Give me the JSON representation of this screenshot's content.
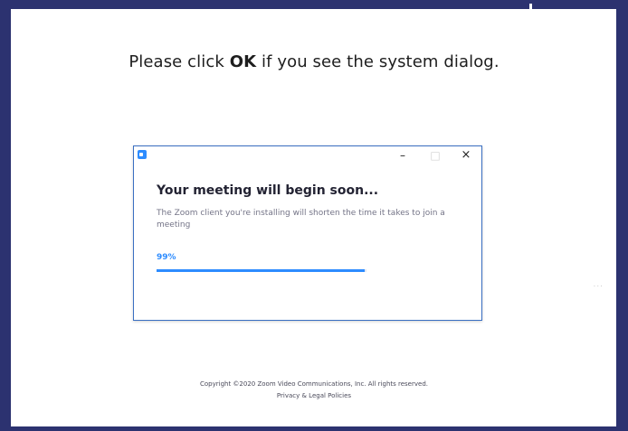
{
  "page": {
    "instruction_prefix": "Please click ",
    "instruction_bold": "OK",
    "instruction_suffix": " if you see the system dialog."
  },
  "dialog": {
    "app_icon": "zoom-app-icon",
    "minimize_label": "–",
    "maximize_label": "□",
    "close_label": "×",
    "title": "Your meeting will begin soon...",
    "description": "The Zoom client you're installing will shorten the time it takes to join a meeting",
    "progress_text": "99%",
    "progress_value": 0.99,
    "accent_color": "#2d8cff"
  },
  "footer": {
    "copyright": "Copyright ©2020 Zoom Video Communications, Inc. All rights reserved.",
    "privacy_link": "Privacy & Legal Policies"
  },
  "frame": {
    "border_color": "#2c3270"
  },
  "decor": {
    "edge_marks": "· · ·"
  }
}
